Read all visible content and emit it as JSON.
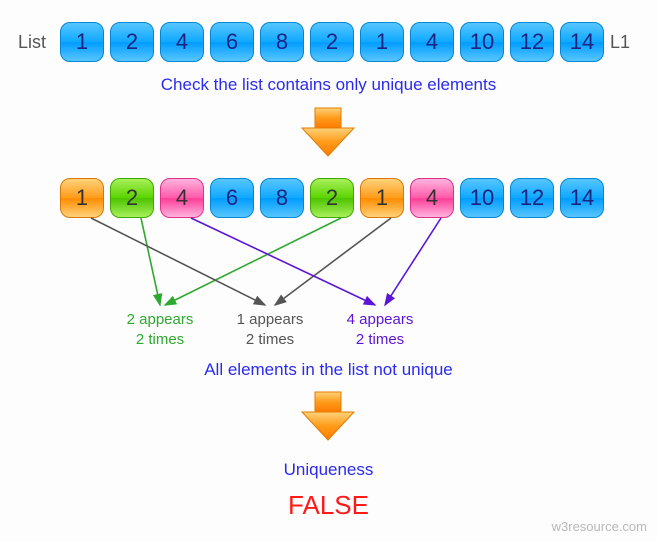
{
  "labels": {
    "list_left": "List",
    "list_right": "L1",
    "caption_top": "Check the list contains only unique elements",
    "caption_mid": "All elements in the list not unique",
    "caption_bottom": "Uniqueness",
    "result": "FALSE",
    "watermark": "w3resource.com"
  },
  "row1": [
    "1",
    "2",
    "4",
    "6",
    "8",
    "2",
    "1",
    "4",
    "10",
    "12",
    "14"
  ],
  "row2": [
    "1",
    "2",
    "4",
    "6",
    "8",
    "2",
    "1",
    "4",
    "10",
    "12",
    "14"
  ],
  "row2_colors": [
    "orange",
    "green",
    "pink",
    "blue",
    "blue",
    "green",
    "orange",
    "pink",
    "blue",
    "blue",
    "blue"
  ],
  "appears": [
    {
      "text_line1": "2 appears",
      "text_line2": "2 times",
      "color": "#2fa82f"
    },
    {
      "text_line1": "1 appears",
      "text_line2": "2 times",
      "color": "#555555"
    },
    {
      "text_line1": "4 appears",
      "text_line2": "2 times",
      "color": "#5a15d6"
    }
  ],
  "chart_data": {
    "type": "table",
    "description": "Diagram illustrating a uniqueness check on a list",
    "input_list": [
      1,
      2,
      4,
      6,
      8,
      2,
      1,
      4,
      10,
      12,
      14
    ],
    "duplicate_groups": [
      {
        "value": 1,
        "indices": [
          0,
          6
        ],
        "count": 2
      },
      {
        "value": 2,
        "indices": [
          1,
          5
        ],
        "count": 2
      },
      {
        "value": 4,
        "indices": [
          2,
          7
        ],
        "count": 2
      }
    ],
    "all_unique": false
  }
}
